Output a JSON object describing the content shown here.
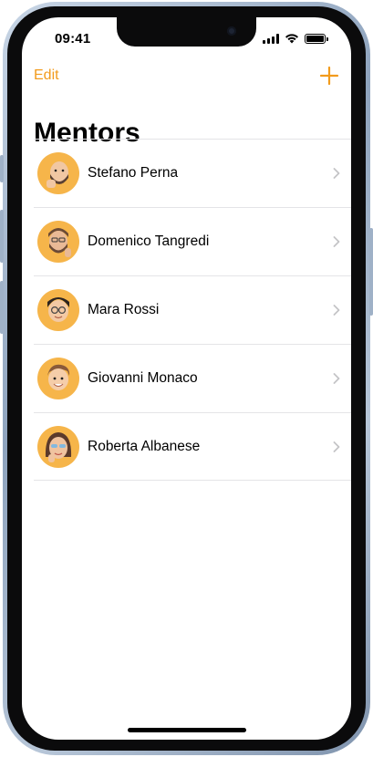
{
  "status_bar": {
    "time": "09:41"
  },
  "nav": {
    "edit_label": "Edit",
    "add_icon": "plus-icon"
  },
  "page": {
    "title": "Mentors"
  },
  "mentors": [
    {
      "name": "Stefano Perna",
      "avatar": "memoji-avatar"
    },
    {
      "name": "Domenico Tangredi",
      "avatar": "memoji-avatar"
    },
    {
      "name": "Mara Rossi",
      "avatar": "memoji-avatar"
    },
    {
      "name": "Giovanni Monaco",
      "avatar": "memoji-avatar"
    },
    {
      "name": "Roberta Albanese",
      "avatar": "memoji-avatar"
    }
  ],
  "colors": {
    "accent": "#f29b1c",
    "avatar_bg": "#f6b54a",
    "separator": "#e4e4e7",
    "chevron": "#c4c4c7",
    "frame": "#8ea3bd"
  }
}
